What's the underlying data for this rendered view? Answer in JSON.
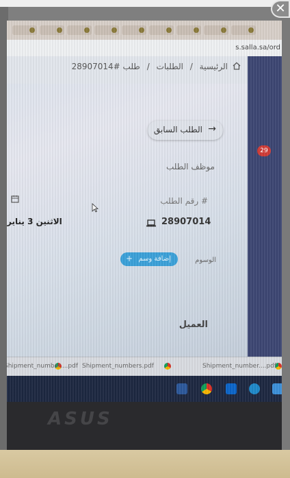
{
  "close_button": "✕",
  "url": "s.salla.sa/ord",
  "breadcrumb": {
    "home": "الرئيسية",
    "separator": "/",
    "orders": "الطلبات",
    "current": "طلب #28907014"
  },
  "notification_badge": "29",
  "prev_order_button": "الطلب السابق",
  "employee_label": "موظف الطلب",
  "order_number_label": "# رقم الطلب",
  "order_number_value": "28907014",
  "order_date": "الاثنين 3 يناير",
  "tags_label": "الوسوم",
  "add_tag_button": "إضافة وسم",
  "customer_label": "العميل",
  "downloads": [
    "Shipment_number....pdf",
    "Shipment_numbers.pdf",
    "Shipment_number....pdf"
  ],
  "laptop_brand": "ASUS",
  "colors": {
    "accent_button": "#3aa0d8",
    "badge": "#cf3a35",
    "sidebar": "#3c4672"
  },
  "icons": [
    "home-icon",
    "arrow-right-icon",
    "laptop-icon",
    "calendar-icon",
    "plus-icon",
    "cursor-icon",
    "pdf-icon"
  ]
}
